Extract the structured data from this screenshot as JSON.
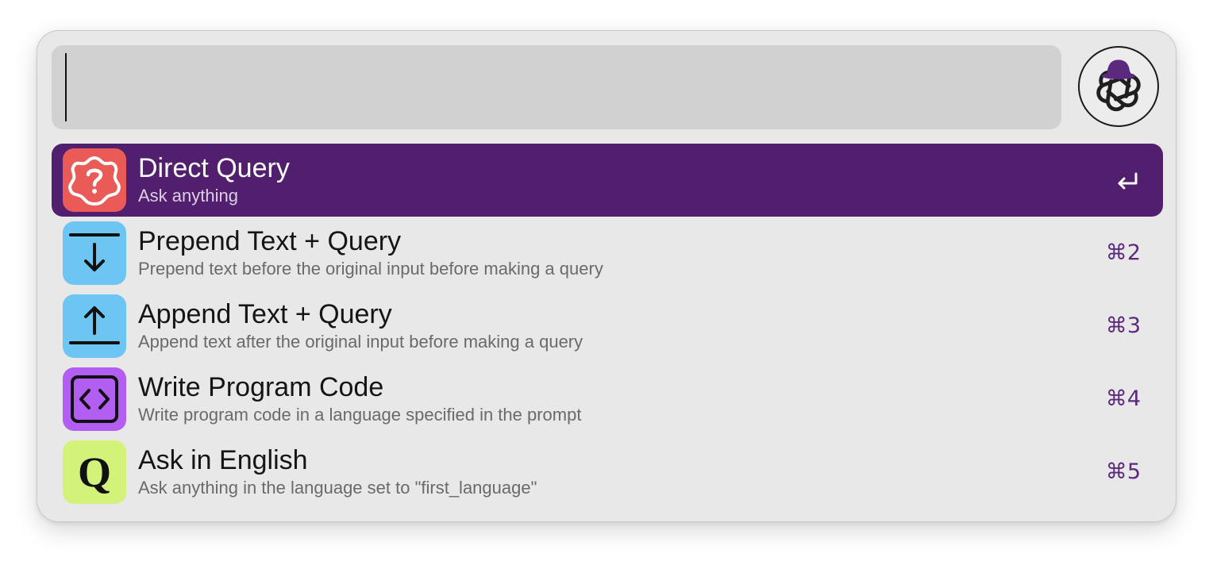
{
  "search": {
    "value": "",
    "placeholder": ""
  },
  "app_logo": {
    "icon": "openai-knot-with-hat-icon",
    "hat_color": "#5b2a7e"
  },
  "results": [
    {
      "id": "direct-query",
      "title": "Direct Query",
      "subtitle": "Ask anything",
      "icon": "question-badge-icon",
      "icon_bg": "#ea5b57",
      "shortcut": "",
      "shortcut_icon": "return-key-icon",
      "selected": true
    },
    {
      "id": "prepend-text-query",
      "title": "Prepend Text + Query",
      "subtitle": "Prepend text before the original input before making a query",
      "icon": "arrow-down-to-line-icon",
      "icon_bg": "#6cc5f2",
      "shortcut": "⌘2",
      "selected": false
    },
    {
      "id": "append-text-query",
      "title": "Append Text + Query",
      "subtitle": "Append text after the original input before making a query",
      "icon": "arrow-up-from-line-icon",
      "icon_bg": "#6cc5f2",
      "shortcut": "⌘3",
      "selected": false
    },
    {
      "id": "write-program-code",
      "title": "Write Program Code",
      "subtitle": "Write program code in a language specified in the prompt",
      "icon": "code-brackets-icon",
      "icon_bg": "#b35ef2",
      "shortcut": "⌘4",
      "selected": false
    },
    {
      "id": "ask-in-english",
      "title": "Ask in English",
      "subtitle": "Ask anything in the language set to \"first_language\"",
      "icon": "letter-q-icon",
      "icon_bg": "#d2f27a",
      "shortcut": "⌘5",
      "selected": false
    }
  ],
  "colors": {
    "selected_row": "#521f6e",
    "shortcut_text": "#5b2a7e",
    "window_bg": "#e8e8e8",
    "search_bg": "#d1d1d1"
  }
}
